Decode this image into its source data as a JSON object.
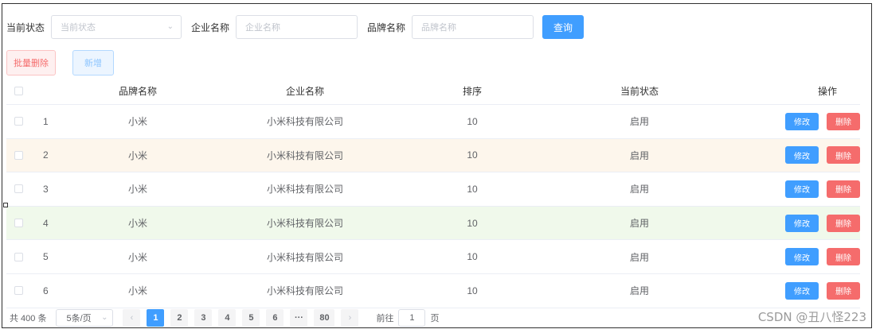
{
  "search": {
    "state_label": "当前状态",
    "state_placeholder": "当前状态",
    "company_label": "企业名称",
    "company_placeholder": "企业名称",
    "brand_label": "品牌名称",
    "brand_placeholder": "品牌名称",
    "query_button": "查询"
  },
  "actions": {
    "batch_delete": "批量删除",
    "add": "新增"
  },
  "table": {
    "headers": {
      "brand": "品牌名称",
      "company": "企业名称",
      "sort": "排序",
      "state": "当前状态",
      "ops": "操作"
    },
    "edit_label": "修改",
    "delete_label": "删除",
    "rows": [
      {
        "index": "1",
        "brand": "小米",
        "company": "小米科技有限公司",
        "sort": "10",
        "state": "启用"
      },
      {
        "index": "2",
        "brand": "小米",
        "company": "小米科技有限公司",
        "sort": "10",
        "state": "启用"
      },
      {
        "index": "3",
        "brand": "小米",
        "company": "小米科技有限公司",
        "sort": "10",
        "state": "启用"
      },
      {
        "index": "4",
        "brand": "小米",
        "company": "小米科技有限公司",
        "sort": "10",
        "state": "启用"
      },
      {
        "index": "5",
        "brand": "小米",
        "company": "小米科技有限公司",
        "sort": "10",
        "state": "启用"
      },
      {
        "index": "6",
        "brand": "小米",
        "company": "小米科技有限公司",
        "sort": "10",
        "state": "启用"
      }
    ]
  },
  "pagination": {
    "total": "共 400 条",
    "page_size": "5条/页",
    "pages": [
      "1",
      "2",
      "3",
      "4",
      "5",
      "6",
      "···",
      "80"
    ],
    "current": "1",
    "goto_prefix": "前往",
    "goto_value": "1",
    "goto_suffix": "页"
  },
  "watermark": "CSDN @丑八怪223",
  "colors": {
    "primary": "#409eff",
    "danger": "#f56c6c",
    "row_warning": "#fdf6ec",
    "row_success": "#f0f9eb"
  }
}
